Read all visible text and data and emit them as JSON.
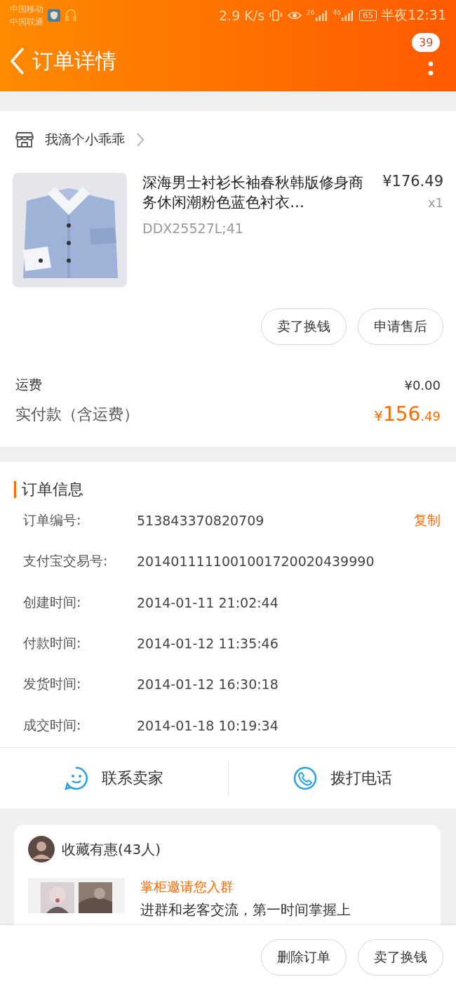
{
  "status_bar": {
    "carriers": [
      "中国移动",
      "中国联通"
    ],
    "speed": "2.9 K/s",
    "network_labels": [
      "26",
      "46"
    ],
    "battery": "65",
    "time": "半夜12:31"
  },
  "header": {
    "title": "订单详情",
    "badge": "39"
  },
  "store": {
    "name": "我滴个小乖乖"
  },
  "product": {
    "title": "深海男士衬衫长袖春秋韩版修身商务休闲潮粉色蓝色衬衣…",
    "sku": "DDX25527L;41",
    "price": "¥176.49",
    "quantity": "x1"
  },
  "item_actions": [
    "卖了换钱",
    "申请售后"
  ],
  "totals": {
    "shipping_label": "运费",
    "shipping_value": "¥0.00",
    "paid_label": "实付款（含运费）",
    "paid_currency": "¥",
    "paid_integer": "156",
    "paid_decimal": ".49"
  },
  "order_info": {
    "title": "订单信息",
    "copy_action": "复制",
    "rows": [
      {
        "label": "订单编号:",
        "value": "513843370820709"
      },
      {
        "label": "支付宝交易号:",
        "value": "2014011111001001720020439990"
      },
      {
        "label": "创建时间:",
        "value": "2014-01-11 21:02:44"
      },
      {
        "label": "付款时间:",
        "value": "2014-01-12 11:35:46"
      },
      {
        "label": "发货时间:",
        "value": "2014-01-12 16:30:18"
      },
      {
        "label": "成交时间:",
        "value": "2014-01-18 10:19:34"
      }
    ]
  },
  "contact_actions": [
    {
      "kind": "chat",
      "label": "联系卖家"
    },
    {
      "kind": "phone",
      "label": "拨打电话"
    }
  ],
  "promo": {
    "title": "收藏有惠(43人)",
    "group_title": "掌柜邀请您入群",
    "group_text": "进群和老客交流，第一时间掌握上"
  },
  "bottom_actions": [
    "删除订单",
    "卖了换钱"
  ]
}
